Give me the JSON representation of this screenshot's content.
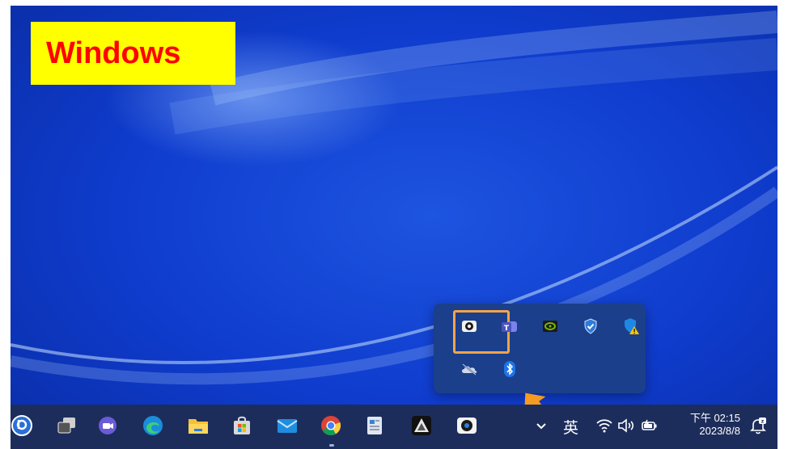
{
  "annotation": {
    "label": "Windows"
  },
  "overflow_tray": {
    "row1": [
      "camera-app-icon",
      "teams-icon",
      "nvidia-icon",
      "defender-icon",
      "security-warning-icon"
    ],
    "row2": [
      "onedrive-offline-icon",
      "bluetooth-icon"
    ]
  },
  "taskbar": {
    "apps": [
      "search-icon",
      "task-view-icon",
      "chat-icon",
      "edge-icon",
      "file-explorer-icon",
      "store-icon",
      "mail-icon",
      "chrome-icon",
      "notepad-icon",
      "app-icon",
      "camera-app-icon"
    ],
    "input_indicator": "英",
    "clock": {
      "time": "下午 02:15",
      "date": "2023/8/8"
    }
  },
  "colors": {
    "annotation_bg": "#ffff00",
    "annotation_text": "#ff0000",
    "highlight": "#f5a44a",
    "taskbar": "#1d2d5b",
    "flyout": "#1b3f8a"
  }
}
